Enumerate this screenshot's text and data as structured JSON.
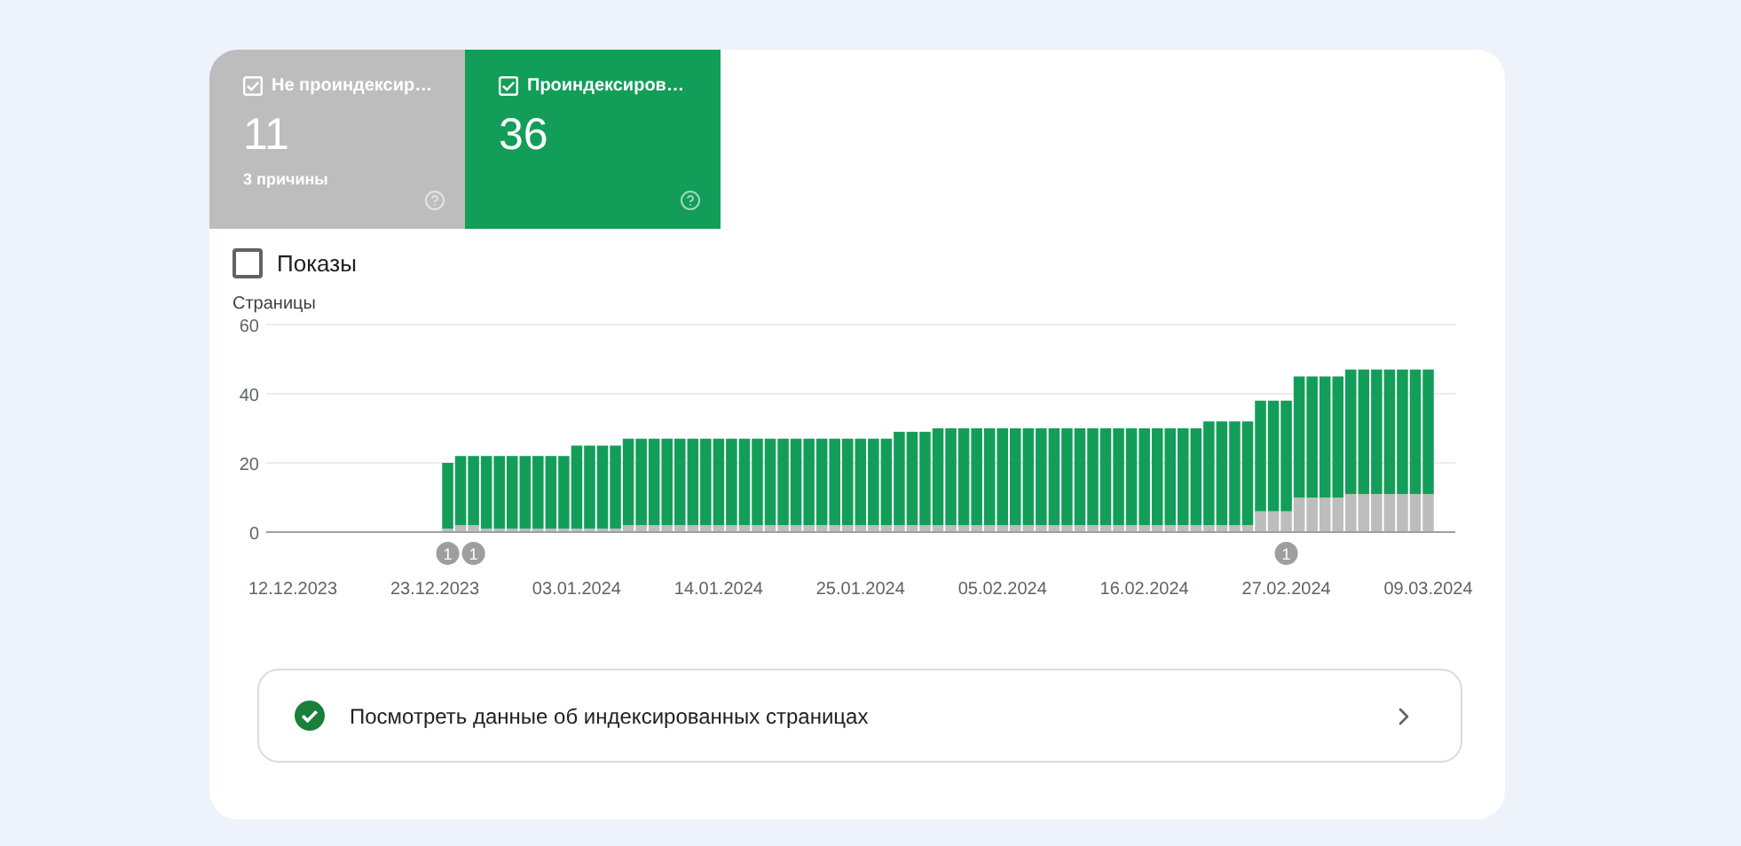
{
  "tiles": [
    {
      "label": "Не проиндексир…",
      "value": "11",
      "sublabel": "3 причины",
      "checked": true,
      "color": "#bdbdbd"
    },
    {
      "label": "Проиндексиров…",
      "value": "36",
      "checked": true,
      "color": "#129e59"
    }
  ],
  "impressions": {
    "label": "Показы",
    "checked": false
  },
  "chart": {
    "chart_data": {
      "type": "bar",
      "stacked": true,
      "ylabel": "Страницы",
      "ylim": [
        0,
        60
      ],
      "yticks": [
        0,
        20,
        40,
        60
      ],
      "categories": [
        "12.12.2023",
        null,
        null,
        null,
        null,
        null,
        null,
        null,
        null,
        null,
        null,
        "23.12.2023",
        null,
        null,
        null,
        null,
        null,
        null,
        null,
        null,
        null,
        null,
        "03.01.2024",
        null,
        null,
        null,
        null,
        null,
        null,
        null,
        null,
        null,
        null,
        "14.01.2024",
        null,
        null,
        null,
        null,
        null,
        null,
        null,
        null,
        null,
        null,
        "25.01.2024",
        null,
        null,
        null,
        null,
        null,
        null,
        null,
        null,
        null,
        null,
        "05.02.2024",
        null,
        null,
        null,
        null,
        null,
        null,
        null,
        null,
        null,
        null,
        "16.02.2024",
        null,
        null,
        null,
        null,
        null,
        null,
        null,
        null,
        null,
        null,
        "27.02.2024",
        null,
        null,
        null,
        null,
        null,
        null,
        null,
        null,
        null,
        null,
        "09.03.2024"
      ],
      "series": [
        {
          "color": "#bdbdbd",
          "values": [
            null,
            null,
            null,
            null,
            null,
            null,
            null,
            null,
            null,
            null,
            null,
            null,
            1,
            2,
            2,
            1,
            1,
            1,
            1,
            1,
            1,
            1,
            1,
            1,
            1,
            1,
            2,
            2,
            2,
            2,
            2,
            2,
            2,
            2,
            2,
            2,
            2,
            2,
            2,
            2,
            2,
            2,
            2,
            2,
            2,
            2,
            2,
            2,
            2,
            2,
            2,
            2,
            2,
            2,
            2,
            2,
            2,
            2,
            2,
            2,
            2,
            2,
            2,
            2,
            2,
            2,
            2,
            2,
            2,
            2,
            2,
            2,
            2,
            2,
            2,
            6,
            6,
            6,
            10,
            10,
            10,
            10,
            11,
            11,
            11,
            11,
            11,
            11,
            11
          ]
        },
        {
          "color": "#129e59",
          "values": [
            null,
            null,
            null,
            null,
            null,
            null,
            null,
            null,
            null,
            null,
            null,
            null,
            19,
            20,
            20,
            21,
            21,
            21,
            21,
            21,
            21,
            21,
            24,
            24,
            24,
            24,
            25,
            25,
            25,
            25,
            25,
            25,
            25,
            25,
            25,
            25,
            25,
            25,
            25,
            25,
            25,
            25,
            25,
            25,
            25,
            25,
            25,
            27,
            27,
            27,
            28,
            28,
            28,
            28,
            28,
            28,
            28,
            28,
            28,
            28,
            28,
            28,
            28,
            28,
            28,
            28,
            28,
            28,
            28,
            28,
            28,
            30,
            30,
            30,
            30,
            32,
            32,
            32,
            35,
            35,
            35,
            35,
            36,
            36,
            36,
            36,
            36,
            36,
            36
          ]
        }
      ],
      "annotations": [
        "1",
        "1",
        "1"
      ]
    }
  },
  "details_link": {
    "label": "Посмотреть данные об индексированных страницах",
    "done": true
  }
}
